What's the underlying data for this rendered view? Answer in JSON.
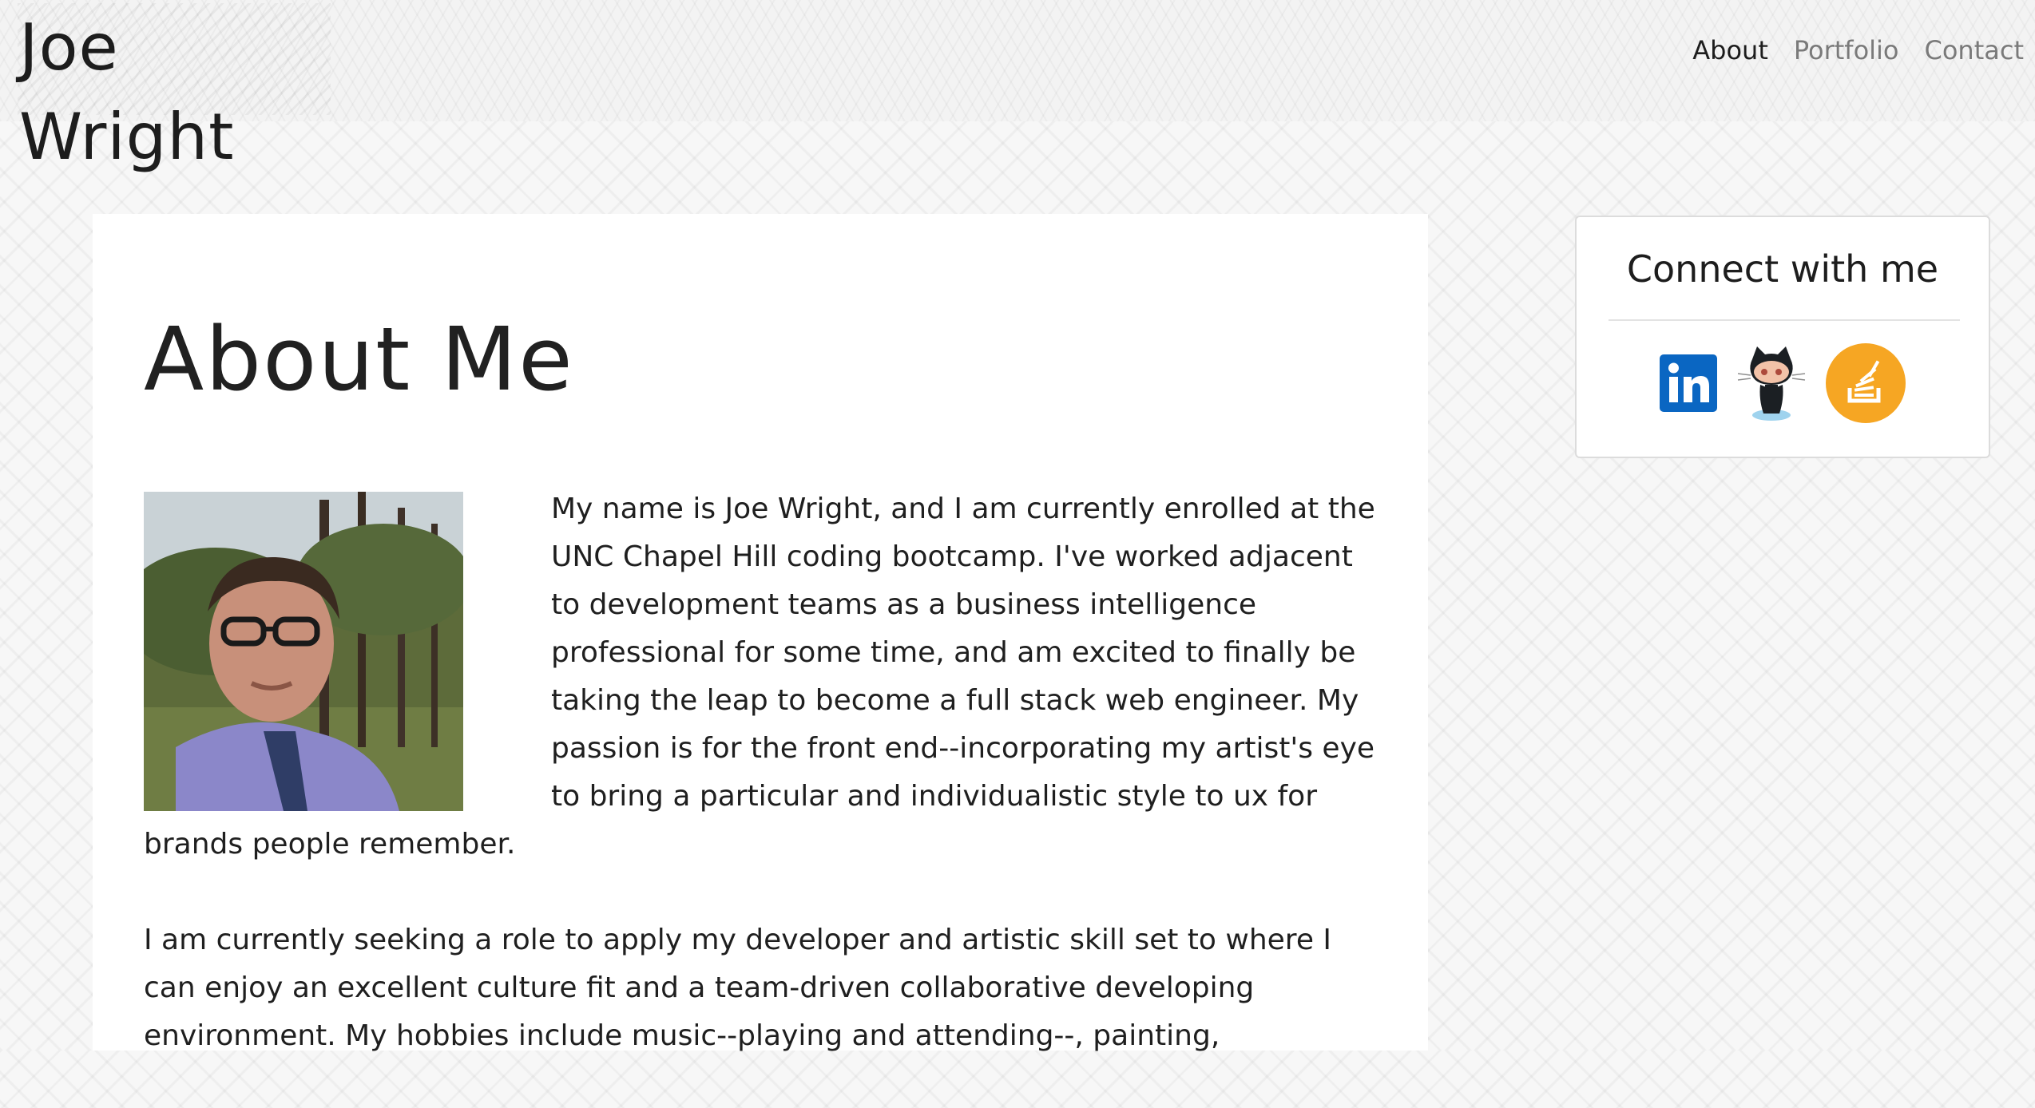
{
  "brand": {
    "name": "Joe Wright"
  },
  "nav": {
    "items": [
      {
        "label": "About",
        "active": true
      },
      {
        "label": "Portfolio",
        "active": false
      },
      {
        "label": "Contact",
        "active": false
      }
    ]
  },
  "main": {
    "heading": "About Me",
    "paragraphs": [
      "My name is Joe Wright, and I am currently enrolled at the UNC Chapel Hill coding bootcamp. I've worked adjacent to development teams as a business intelligence professional for some time, and am excited to finally be taking the leap to become a full stack web engineer. My passion is for the front end--incorporating my artist's eye to bring a particular and individualistic style to ux for brands people remember.",
      "I am currently seeking a role to apply my developer and artistic skill set to where I can enjoy an excellent culture fit and a team-driven collaborative developing environment. My hobbies include music--playing and attending--, painting,"
    ]
  },
  "sidebar": {
    "title": "Connect with me",
    "links": [
      {
        "icon": "linkedin-icon",
        "color": "#0a66c2"
      },
      {
        "icon": "github-octocat-icon",
        "color": "#1b1f23"
      },
      {
        "icon": "stackoverflow-icon",
        "color": "#f6a623"
      }
    ]
  }
}
